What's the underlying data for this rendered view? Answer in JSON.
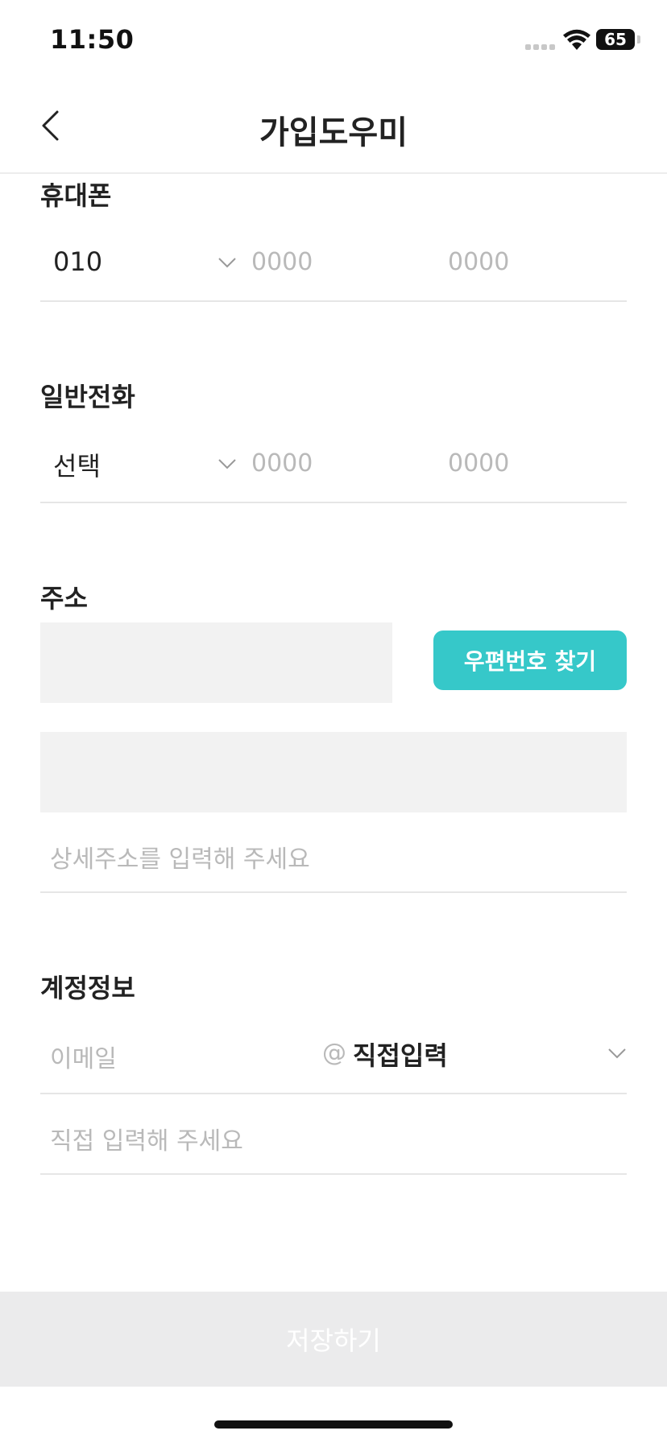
{
  "status_bar": {
    "time": "11:50",
    "battery": "65"
  },
  "header": {
    "title": "가입도우미"
  },
  "mobile": {
    "label": "휴대폰",
    "prefix": "010",
    "mid_placeholder": "0000",
    "last_placeholder": "0000"
  },
  "landline": {
    "label": "일반전화",
    "prefix": "선택",
    "mid_placeholder": "0000",
    "last_placeholder": "0000"
  },
  "address": {
    "label": "주소",
    "zip_button": "우편번호 찾기",
    "detail_placeholder": "상세주소를 입력해 주세요"
  },
  "account": {
    "label": "계정정보",
    "email_placeholder": "이메일",
    "at_sign": "@",
    "domain_select": "직접입력",
    "domain_placeholder": "직접 입력해 주세요"
  },
  "footer": {
    "save_label": "저장하기"
  },
  "colors": {
    "accent": "#36c8c9",
    "disabled_button": "#ebebec",
    "placeholder": "#b9b9b9"
  }
}
